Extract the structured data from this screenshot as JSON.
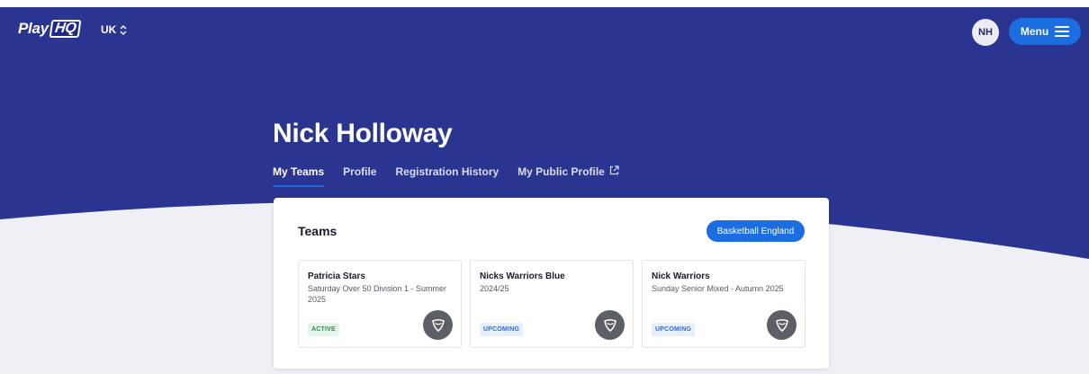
{
  "header": {
    "logo_text": "Play",
    "logo_badge": "HQ",
    "region": "UK",
    "avatar_initials": "NH",
    "menu_label": "Menu"
  },
  "profile": {
    "name": "Nick Holloway",
    "tabs": [
      {
        "label": "My Teams",
        "active": true
      },
      {
        "label": "Profile",
        "active": false
      },
      {
        "label": "Registration History",
        "active": false
      },
      {
        "label": "My Public Profile",
        "active": false,
        "icon": "external-link-icon"
      }
    ]
  },
  "teams_panel": {
    "title": "Teams",
    "organisation_button": "Basketball England",
    "teams": [
      {
        "name": "Patricia Stars",
        "subtitle": "Saturday Over 50 Division 1 - Summer 2025",
        "status": "ACTIVE",
        "icon": "team-shield-icon"
      },
      {
        "name": "Nicks Warriors Blue",
        "subtitle": "2024/25",
        "status": "UPCOMING",
        "icon": "team-shield-icon"
      },
      {
        "name": "Nick Warriors",
        "subtitle": "Sunday Senior Mixed - Autumn 2025",
        "status": "UPCOMING",
        "icon": "team-shield-icon"
      }
    ]
  },
  "colors": {
    "hero_blue": "#2a3591",
    "accent_blue": "#1b6de0",
    "page_bg": "#eef0f5"
  }
}
